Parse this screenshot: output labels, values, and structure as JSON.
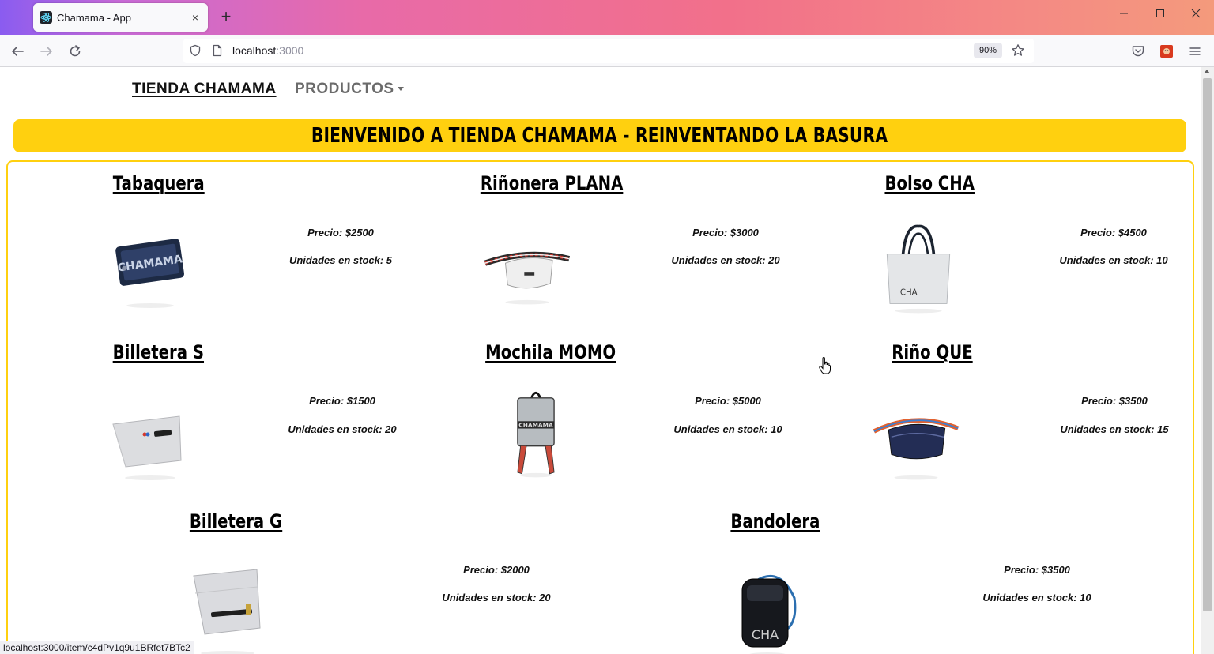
{
  "browser": {
    "tab_title": "Chamama - App",
    "tab_close": "×",
    "new_tab": "+",
    "url_host": "localhost",
    "url_port": ":3000",
    "zoom": "90%",
    "status_url": "localhost:3000/item/c4dPv1q9u1BRfet7BTc2"
  },
  "site": {
    "brand": "TIENDA CHAMAMA",
    "menu": "PRODUCTOS",
    "banner": "BIENVENIDO A TIENDA CHAMAMA - REINVENTANDO LA BASURA"
  },
  "products": [
    {
      "name": "Tabaquera",
      "price": "Precio: $2500",
      "stock": "Unidades en stock: 5",
      "icon": "tabaquera-image"
    },
    {
      "name": "Riñonera PLANA",
      "price": "Precio: $3000",
      "stock": "Unidades en stock: 20",
      "icon": "rinonera-plana-image"
    },
    {
      "name": "Bolso CHA",
      "price": "Precio: $4500",
      "stock": "Unidades en stock: 10",
      "icon": "bolso-cha-image"
    },
    {
      "name": "Billetera S",
      "price": "Precio: $1500",
      "stock": "Unidades en stock: 20",
      "icon": "billetera-s-image"
    },
    {
      "name": "Mochila MOMO",
      "price": "Precio: $5000",
      "stock": "Unidades en stock: 10",
      "icon": "mochila-momo-image"
    },
    {
      "name": "Riño QUE",
      "price": "Precio: $3500",
      "stock": "Unidades en stock: 15",
      "icon": "rino-que-image"
    },
    {
      "name": "Billetera G",
      "price": "Precio: $2000",
      "stock": "Unidades en stock: 20",
      "icon": "billetera-g-image"
    },
    {
      "name": "Bandolera",
      "price": "Precio: $3500",
      "stock": "Unidades en stock: 10",
      "icon": "bandolera-image"
    }
  ],
  "image_text": {
    "tabaquera": "CHAMAMA",
    "bolso": "CHA",
    "mochila": "CHAMAMA",
    "bandolera": "CHA"
  },
  "colors": {
    "accent_yellow": "#ffd00f",
    "text": "#111111",
    "menu_grey": "#6b6b6b"
  }
}
